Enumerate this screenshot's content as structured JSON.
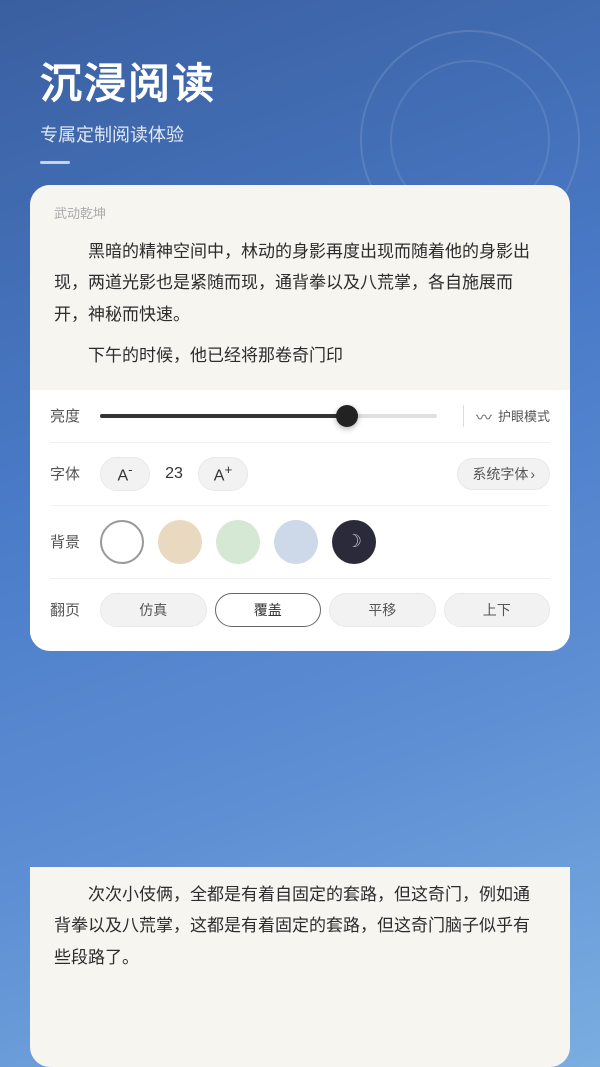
{
  "header": {
    "title": "沉浸阅读",
    "subtitle": "专属定制阅读体验"
  },
  "book": {
    "title": "武动乾坤",
    "paragraph1": "黑暗的精神空间中，林动的身影再度出现而随着他的身影出现，两道光影也是紧随而现，通背拳以及八荒掌，各自施展而开，神秘而快速。",
    "paragraph2": "下午的时候，他已经将那卷奇门印"
  },
  "settings": {
    "brightness_label": "亮度",
    "brightness_value": 72,
    "eye_mode_label": "护眼模式",
    "font_label": "字体",
    "font_size": "23",
    "font_decrease": "A⁻",
    "font_increase": "A⁺",
    "font_family": "系统字体",
    "bg_label": "背景",
    "bg_options": [
      "white",
      "beige",
      "green",
      "blue",
      "dark"
    ],
    "page_label": "翻页",
    "page_options": [
      "仿真",
      "覆盖",
      "平移",
      "上下"
    ],
    "page_active": "覆盖"
  },
  "bottom_text": {
    "content": "次次小伎俩，全都是有着自固定的套路，但这奇门，例如通背拳以及八荒掌，这都是有着固定的套路，但这奇门脑子似乎有些段路了。"
  }
}
